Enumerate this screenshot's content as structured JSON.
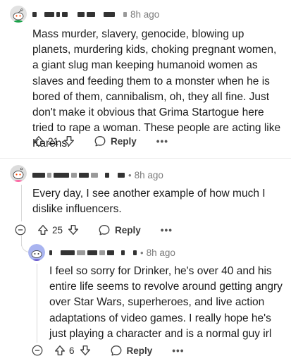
{
  "comments": [
    {
      "time": "8h ago",
      "text": "Mass murder, slavery, genocide, blowing up planets, murdering kids, choking pregnant women, a giant slug man keeping humanoid women as slaves and feeding them to a monster when he is bored of them, cannibalism, oh, they all fine. Just don't make it obvious that Grima Startogue here tried to rape a woman. These people are acting like Karens.",
      "votes": "21",
      "reply_label": "Reply",
      "more_label": "•••"
    },
    {
      "time": "8h ago",
      "text": "Every day, I see another example of how much I dislike influencers.",
      "votes": "25",
      "reply_label": "Reply",
      "more_label": "•••"
    },
    {
      "time": "8h ago",
      "text": "I feel so sorry for Drinker, he's over 40 and his entire life seems to revolve around getting angry over Star Wars, superheroes, and live action adaptations of video games. I really hope he's just playing a character and is a normal guy irl",
      "votes": "6",
      "reply_label": "Reply",
      "more_label": "•••"
    }
  ],
  "separator": "•",
  "colors": {
    "text": "#1c1c1c",
    "meta": "#7c7c7c",
    "thread": "#d8d8d8",
    "avatar1": "#e2e2e2",
    "avatar2": "#dcdcdc",
    "avatar3": "#a9b4f0"
  },
  "icons": [
    "upvote-icon",
    "downvote-icon",
    "reply-bubble-icon",
    "collapse-minus-icon",
    "more-dots-icon"
  ]
}
